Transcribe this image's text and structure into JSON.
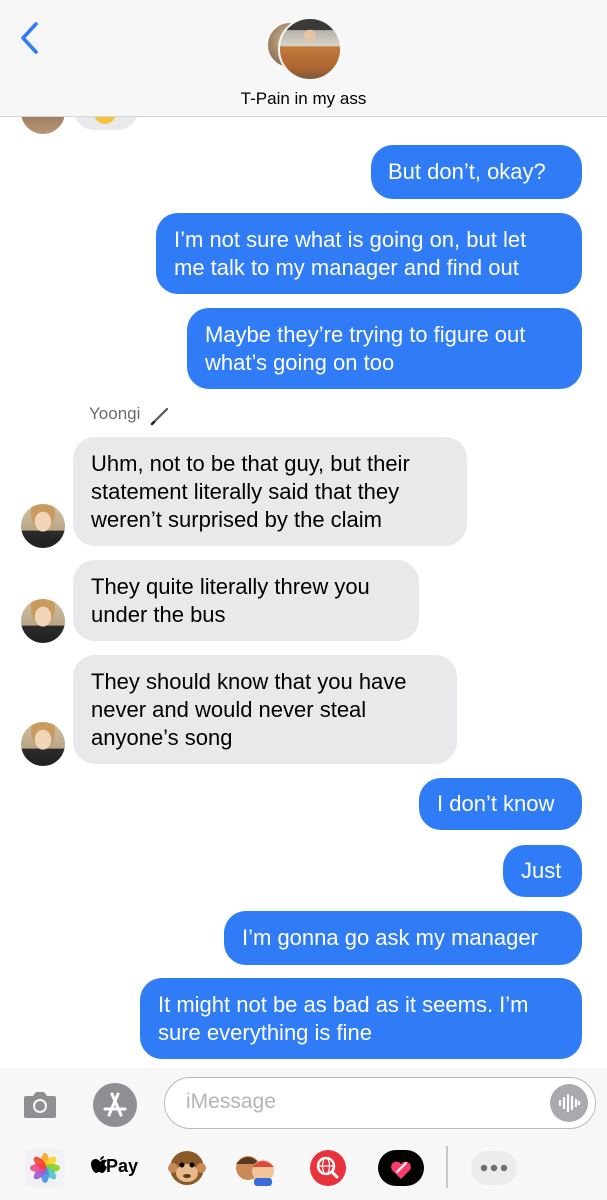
{
  "header": {
    "back_label": "<",
    "title": "T-Pain in my ass"
  },
  "thread": {
    "messages": [
      {
        "dir": "out",
        "lines": [
          "But don’t, okay?"
        ]
      },
      {
        "dir": "out",
        "lines": [
          "I’m not sure what is going on, but let",
          "me talk to my manager and find out"
        ]
      },
      {
        "dir": "out",
        "lines": [
          "Maybe they’re trying to figure out",
          "what’s going on too"
        ]
      },
      {
        "dir": "in",
        "sender": "Yoongi",
        "lines": [
          "Uhm, not to be that guy, but their",
          "statement literally said that they",
          "weren’t surprised by the claim"
        ]
      },
      {
        "dir": "in",
        "lines": [
          "They quite literally threw you",
          "under the bus"
        ]
      },
      {
        "dir": "in",
        "lines": [
          "They should know that you have",
          "never and would never steal",
          "anyone’s song"
        ]
      },
      {
        "dir": "out",
        "lines": [
          "I don’t know"
        ]
      },
      {
        "dir": "out",
        "lines": [
          "Just"
        ]
      },
      {
        "dir": "out",
        "lines": [
          "I’m gonna go ask my manager"
        ]
      },
      {
        "dir": "out",
        "lines": [
          "It might not be as bad as it seems. I’m",
          "sure everything is fine"
        ]
      }
    ],
    "sender_name": "Yoongi"
  },
  "input": {
    "placeholder": "iMessage"
  },
  "app_strip": {
    "apple_pay_label": "Pay",
    "items": [
      "photos-icon",
      "apple-pay-icon",
      "animoji-icon",
      "memoji-icon",
      "web-search-icon",
      "digital-touch-icon",
      "more-apps-icon"
    ]
  },
  "colors": {
    "outgoing_bubble": "#2f7cf6",
    "incoming_bubble": "#e9e9eb",
    "accent": "#2f7cf6"
  }
}
